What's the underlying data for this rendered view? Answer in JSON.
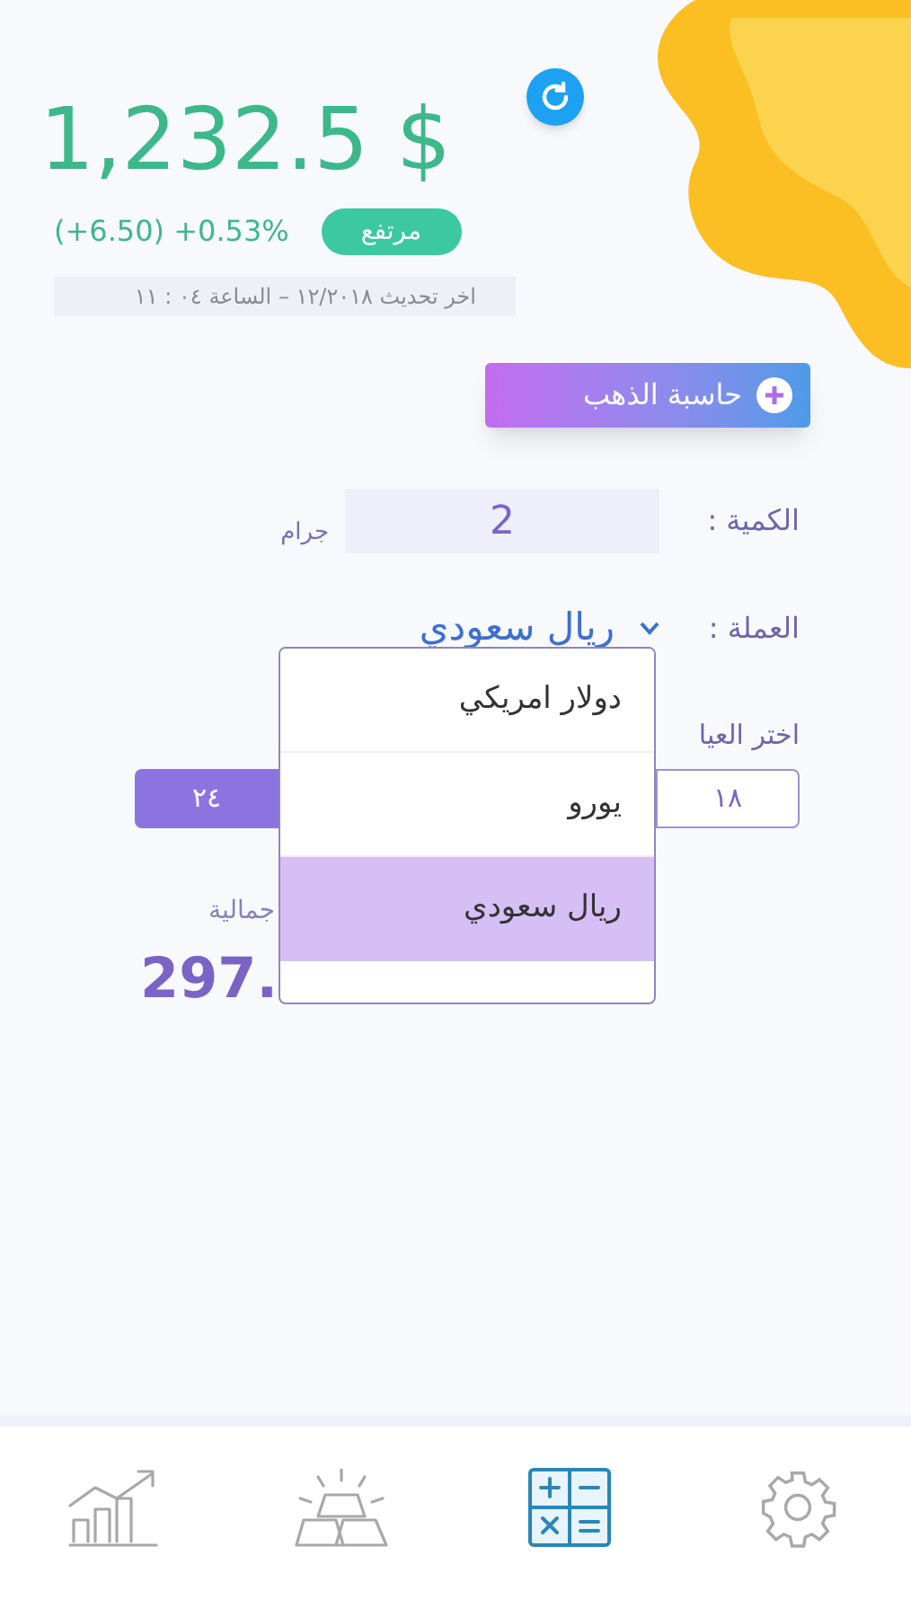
{
  "header": {
    "price": "1,232.5 $",
    "trend_badge": "مرتفع",
    "change": "(+6.50) +0.53%",
    "last_update": "اخر تحديث ١٢/٢٠١٨ – الساعة ٠٤ : ١١"
  },
  "calculator_button": "حاسبة الذهب",
  "quantity": {
    "label": "الكمية :",
    "value": "2",
    "unit": "جرام"
  },
  "currency": {
    "label": "العملة :",
    "value": "ريال سعودي"
  },
  "karat": {
    "label": "اختر العيا",
    "options": [
      {
        "label": "١٨",
        "selected": false
      },
      {
        "label": "٢٤",
        "selected": true
      }
    ]
  },
  "total": {
    "label": "جمالية",
    "value": "297."
  },
  "currency_dropdown": [
    {
      "label": "دولار امريكي",
      "selected": false
    },
    {
      "label": "يورو",
      "selected": false
    },
    {
      "label": "ريال سعودي",
      "selected": true
    }
  ],
  "bottom_nav": [
    {
      "kind": "chart",
      "selected": false
    },
    {
      "kind": "gold",
      "selected": false
    },
    {
      "kind": "calculator",
      "selected": true
    },
    {
      "kind": "settings",
      "selected": false
    }
  ]
}
